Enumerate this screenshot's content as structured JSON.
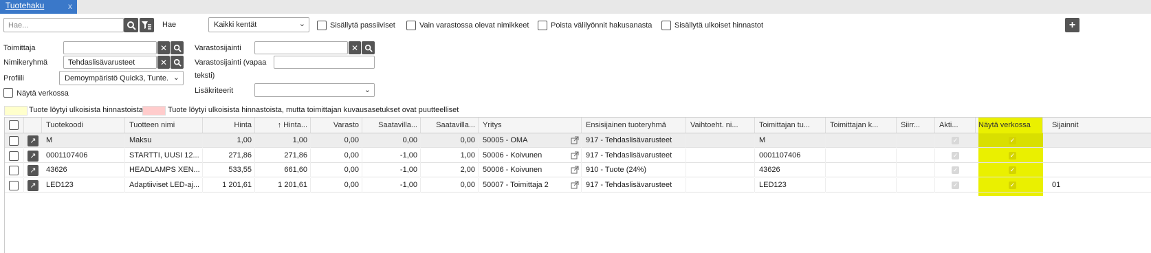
{
  "tab": {
    "title": "Tuotehaku",
    "close": "x"
  },
  "search": {
    "placeholder": "Hae...",
    "hae_label": "Hae",
    "field_select": "Kaikki kentät"
  },
  "options": {
    "passive": "Sisällytä passiiviset",
    "in_stock": "Vain varastossa olevat nimikkeet",
    "strip_spaces": "Poista välilyönnit hakusanasta",
    "external": "Sisällytä ulkoiset hinnastot"
  },
  "add_button": "+",
  "filters": {
    "toimittaja": "Toimittaja",
    "nimikeryhma": "Nimikeryhmä",
    "nimikeryhma_value": "Tehdaslisävarusteet",
    "profiili": "Profiili",
    "profiili_value": "Demoympäristö Quick3, Tunte...",
    "nayta_verkossa": "Näytä verkossa",
    "varastosijainti": "Varastosijainti",
    "varastosijainti_free_1": "Varastosijainti (vapaa",
    "varastosijainti_free_2": "teksti)",
    "lisakriteerit": "Lisäkriteerit"
  },
  "legend": {
    "yellow_color": "#ffffcc",
    "yellow_text": "Tuote löytyi ulkoisista hinnastoista",
    "pink_color": "#ffcccc",
    "pink_text": "Tuote löytyi ulkoisista hinnastoista, mutta toimittajan kuvausasetukset ovat puutteelliset"
  },
  "columns": {
    "code": "Tuotekoodi",
    "name": "Tuotteen nimi",
    "price": "Hinta",
    "price2": "↑ Hinta...",
    "stock": "Varasto",
    "avail1": "Saatavilla...",
    "avail2": "Saatavilla...",
    "company": "Yritys",
    "group": "Ensisijainen tuoteryhmä",
    "alt": "Vaihtoeht. ni...",
    "supplier_code": "Toimittajan tu...",
    "supplier_k": "Toimittajan k...",
    "siir": "Siirr...",
    "active": "Akti...",
    "show_web": "Näytä verkossa",
    "location": "Sijainnit"
  },
  "rows": [
    {
      "code": "M",
      "name": "Maksu",
      "price": "1,00",
      "price2": "1,00",
      "stock": "0,00",
      "avail1": "0,00",
      "avail2": "0,00",
      "company": "50005 - OMA",
      "group": "917 - Tehdaslisävarusteet",
      "alt": "",
      "supplier_code": "M",
      "supplier_k": "",
      "siir": "",
      "location": ""
    },
    {
      "code": "0001107406",
      "name": "STARTTI, UUSI 12...",
      "price": "271,86",
      "price2": "271,86",
      "stock": "0,00",
      "avail1": "-1,00",
      "avail2": "1,00",
      "company": "50006 - Koivunen",
      "group": "917 - Tehdaslisävarusteet",
      "alt": "",
      "supplier_code": "0001107406",
      "supplier_k": "",
      "siir": "",
      "location": ""
    },
    {
      "code": "43626",
      "name": "HEADLAMPS XEN...",
      "price": "533,55",
      "price2": "661,60",
      "stock": "0,00",
      "avail1": "-1,00",
      "avail2": "2,00",
      "company": "50006 - Koivunen",
      "group": "910 - Tuote (24%)",
      "alt": "",
      "supplier_code": "43626",
      "supplier_k": "",
      "siir": "",
      "location": ""
    },
    {
      "code": "LED123",
      "name": "Adaptiiviset LED-aj...",
      "price": "1 201,61",
      "price2": "1 201,61",
      "stock": "0,00",
      "avail1": "-1,00",
      "avail2": "0,00",
      "company": "50007 - Toimittaja 2",
      "group": "917 - Tehdaslisävarusteet",
      "alt": "",
      "supplier_code": "LED123",
      "supplier_k": "",
      "siir": "",
      "location": "01"
    }
  ],
  "highlight_color": "#eaf000"
}
